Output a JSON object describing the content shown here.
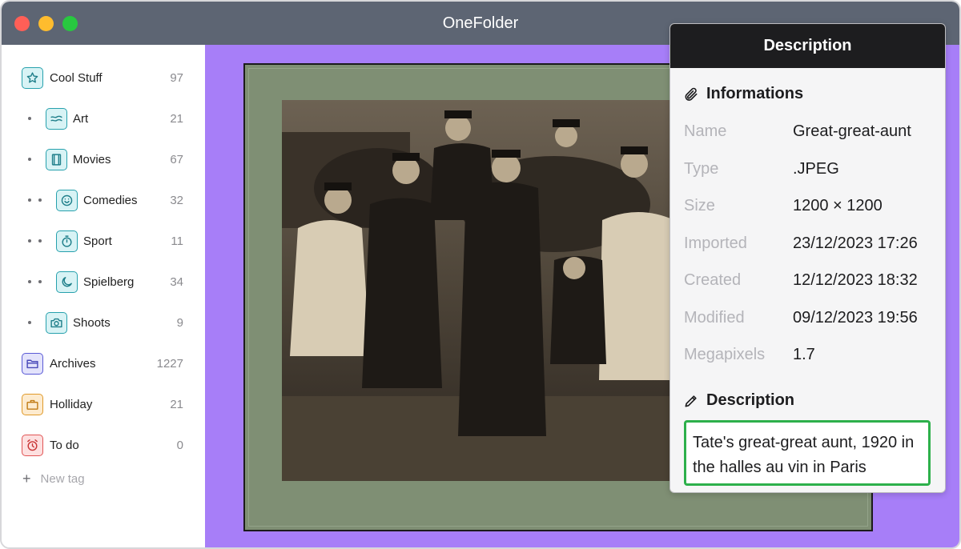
{
  "window": {
    "title": "OneFolder"
  },
  "sidebar": {
    "tags": [
      {
        "label": "Cool Stuff",
        "count": "97",
        "icon": "star-icon",
        "color": "teal"
      },
      {
        "label": "Art",
        "count": "21",
        "icon": "waves-icon",
        "color": "teal"
      },
      {
        "label": "Movies",
        "count": "67",
        "icon": "film-icon",
        "color": "teal"
      },
      {
        "label": "Comedies",
        "count": "32",
        "icon": "smile-icon",
        "color": "teal"
      },
      {
        "label": "Sport",
        "count": "11",
        "icon": "stopwatch-icon",
        "color": "teal"
      },
      {
        "label": "Spielberg",
        "count": "34",
        "icon": "moon-icon",
        "color": "teal"
      },
      {
        "label": "Shoots",
        "count": "9",
        "icon": "camera-icon",
        "color": "teal"
      },
      {
        "label": "Archives",
        "count": "1227",
        "icon": "folder-icon",
        "color": "indigo"
      },
      {
        "label": "Holliday",
        "count": "21",
        "icon": "briefcase-icon",
        "color": "orange"
      },
      {
        "label": "To do",
        "count": "0",
        "icon": "alarm-icon",
        "color": "red"
      }
    ],
    "new_tag": "New tag"
  },
  "panel": {
    "title": "Description",
    "info_title": "Informations",
    "info": [
      {
        "key": "Name",
        "value": "Great-great-aunt"
      },
      {
        "key": "Type",
        "value": ".JPEG"
      },
      {
        "key": "Size",
        "value": "1200 × 1200"
      },
      {
        "key": "Imported",
        "value": "23/12/2023 17:26"
      },
      {
        "key": "Created",
        "value": "12/12/2023 18:32"
      },
      {
        "key": "Modified",
        "value": "09/12/2023 19:56"
      },
      {
        "key": "Megapixels",
        "value": "1.7"
      }
    ],
    "description_title": "Description",
    "description_text": "Tate's great-great aunt, 1920 in the halles au vin in Paris"
  },
  "colors": {
    "main_bg": "#a77ef8",
    "accent_green": "#2db04b",
    "titlebar": "#5d6573"
  }
}
